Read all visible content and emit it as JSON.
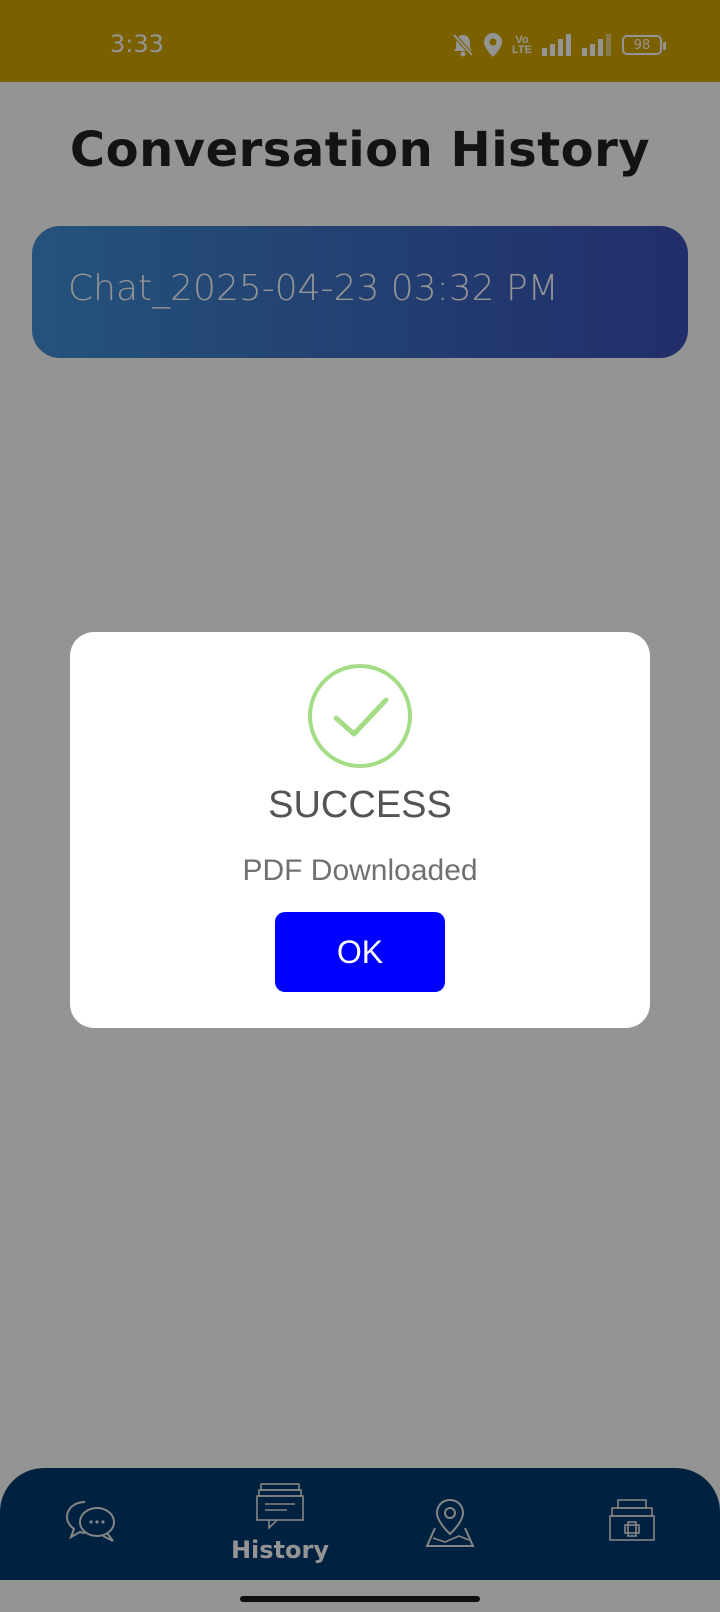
{
  "status_bar": {
    "time": "3:33",
    "volte_label": "Vo\nLTE",
    "battery_level": "98"
  },
  "page": {
    "title": "Conversation History",
    "chats": [
      {
        "label": "Chat_2025-04-23 03:32 PM"
      }
    ]
  },
  "bottom_nav": {
    "items": [
      {
        "icon": "chat-bubbles-icon",
        "label": ""
      },
      {
        "icon": "history-icon",
        "label": "History",
        "active": true
      },
      {
        "icon": "map-pin-icon",
        "label": ""
      },
      {
        "icon": "hospital-icon",
        "label": ""
      }
    ]
  },
  "dialog": {
    "icon": "success-check-icon",
    "title": "SUCCESS",
    "message": "PDF Downloaded",
    "ok_label": "OK"
  },
  "colors": {
    "status_bar": "#d4a600",
    "nav": "#003a6e",
    "ok_button": "#0000ff",
    "check": "#a5dc86"
  }
}
